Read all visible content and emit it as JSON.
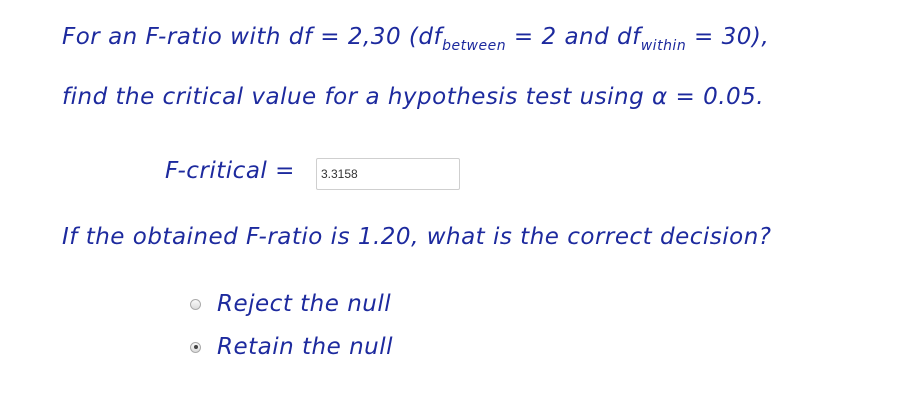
{
  "question": {
    "line1_part1": "For an F-ratio with df = 2,30  (df",
    "df_between_sub": "between",
    "line1_part2": " = 2 and df",
    "df_within_sub": "within",
    "line1_part3": " = 30),",
    "line2": "find the critical value for a hypothesis test using α = 0.05."
  },
  "f_critical": {
    "label": "F-critical  =",
    "value": "3.3158"
  },
  "decision_question": "If the obtained F-ratio is 1.20, what is the correct decision?",
  "options": [
    {
      "label": "Reject the null",
      "selected": false
    },
    {
      "label": "Retain the null",
      "selected": true
    }
  ]
}
